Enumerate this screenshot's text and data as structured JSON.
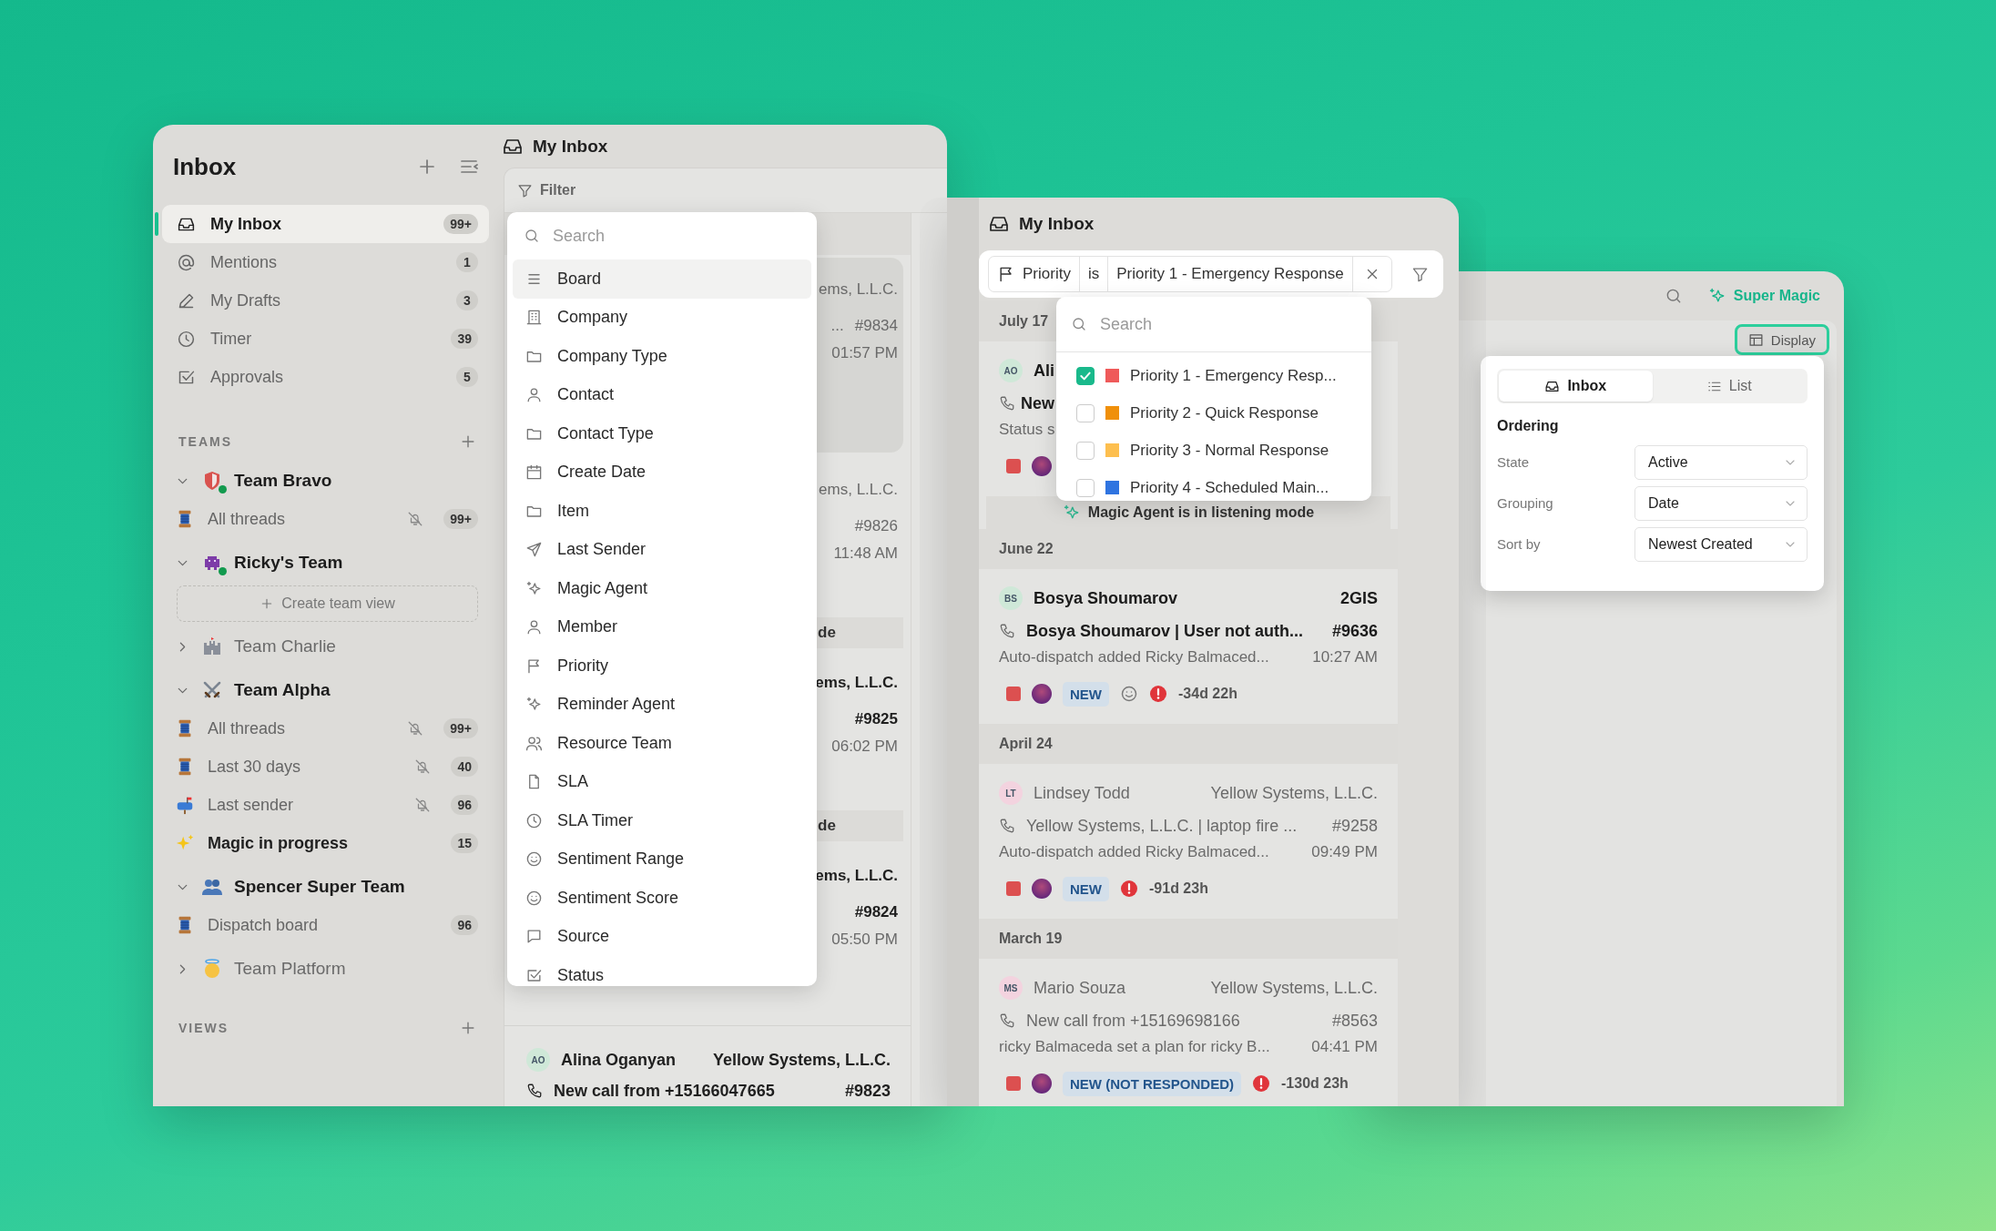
{
  "inbox_window": {
    "sidebar": {
      "title": "Inbox",
      "nav": [
        {
          "label": "My Inbox",
          "count": "99+",
          "selected": true
        },
        {
          "label": "Mentions",
          "count": "1",
          "selected": false
        },
        {
          "label": "My Drafts",
          "count": "3",
          "selected": false
        },
        {
          "label": "Timer",
          "count": "39",
          "selected": false
        },
        {
          "label": "Approvals",
          "count": "5",
          "selected": false
        }
      ],
      "teams_heading": "TEAMS",
      "teams": [
        {
          "name": "Team Bravo",
          "expanded": true,
          "online": true,
          "children": [
            {
              "kind": "view",
              "label": "All threads",
              "muted": true,
              "unread": false,
              "count": "99+"
            }
          ]
        },
        {
          "name": "Ricky's Team",
          "expanded": true,
          "online": true,
          "children": [
            {
              "kind": "create",
              "label": "Create team view"
            }
          ]
        },
        {
          "name": "Team Charlie",
          "expanded": false,
          "online": false
        },
        {
          "name": "Team Alpha",
          "expanded": true,
          "online": false,
          "children": [
            {
              "kind": "view",
              "label": "All threads",
              "muted": true,
              "unread": false,
              "count": "99+"
            },
            {
              "kind": "view",
              "label": "Last 30 days",
              "muted": true,
              "unread": false,
              "count": "40"
            },
            {
              "kind": "view",
              "label": "Last sender",
              "muted": true,
              "unread": false,
              "count": "96"
            },
            {
              "kind": "view",
              "label": "Magic in progress",
              "muted": false,
              "unread": true,
              "count": "15"
            }
          ]
        },
        {
          "name": "Spencer Super Team",
          "expanded": true,
          "online": false,
          "children": [
            {
              "kind": "view",
              "label": "Dispatch board",
              "muted": false,
              "unread": false,
              "count": "96"
            }
          ]
        },
        {
          "name": "Team Platform",
          "expanded": false,
          "online": false
        }
      ],
      "views_heading": "VIEWS"
    },
    "panel": {
      "title": "My Inbox",
      "filter_label": "Filter",
      "filter_menu": {
        "placeholder": "Search",
        "items": [
          {
            "label": "Board",
            "selected": true
          },
          {
            "label": "Company",
            "selected": false
          },
          {
            "label": "Company Type",
            "selected": false
          },
          {
            "label": "Contact",
            "selected": false
          },
          {
            "label": "Contact Type",
            "selected": false
          },
          {
            "label": "Create Date",
            "selected": false
          },
          {
            "label": "Item",
            "selected": false
          },
          {
            "label": "Last Sender",
            "selected": false
          },
          {
            "label": "Magic Agent",
            "selected": false
          },
          {
            "label": "Member",
            "selected": false
          },
          {
            "label": "Priority",
            "selected": false
          },
          {
            "label": "Reminder Agent",
            "selected": false
          },
          {
            "label": "Resource Team",
            "selected": false
          },
          {
            "label": "SLA",
            "selected": false
          },
          {
            "label": "SLA Timer",
            "selected": false
          },
          {
            "label": "Sentiment Range",
            "selected": false
          },
          {
            "label": "Sentiment Score",
            "selected": false
          },
          {
            "label": "Source",
            "selected": false
          },
          {
            "label": "Status",
            "selected": false
          }
        ]
      },
      "rows": [
        {
          "kind": "fragment",
          "company": "ems, L.L.C.",
          "subject": "...",
          "ticket": "#9834",
          "time": "01:57 PM",
          "selected": true,
          "unread": false
        },
        {
          "kind": "fragment",
          "company": "ems, L.L.C.",
          "ticket": "#9826",
          "time": "11:48 AM",
          "selected": false,
          "unread": false
        },
        {
          "kind": "band",
          "text": "de"
        },
        {
          "kind": "fragment",
          "company": "ems, L.L.C.",
          "ticket": "#9825",
          "time": "06:02 PM",
          "selected": false,
          "unread": true
        },
        {
          "kind": "band",
          "text": "de"
        },
        {
          "kind": "fragment",
          "company": "ems, L.L.C.",
          "ticket": "#9824",
          "time": "05:50 PM",
          "selected": false,
          "unread": true
        },
        {
          "kind": "thread",
          "initials": "AO",
          "color": "#cfe8d8",
          "name": "Alina Oganyan",
          "company": "Yellow Systems, L.L.C.",
          "subject": "New call from +15166047665",
          "ticket": "#9823",
          "unread": true
        }
      ]
    }
  },
  "filtered_window": {
    "title": "My Inbox",
    "filter": {
      "field": "Priority",
      "operator": "is",
      "value": "Priority 1 - Emergency Response"
    },
    "priority_menu": {
      "placeholder": "Search",
      "options": [
        {
          "label": "Priority 1 - Emergency Resp...",
          "checked": true,
          "color": "#ef5a5a"
        },
        {
          "label": "Priority 2 - Quick Response",
          "checked": false,
          "color": "#f0900a"
        },
        {
          "label": "Priority 3 - Normal Response",
          "checked": false,
          "color": "#fdbf4f"
        },
        {
          "label": "Priority 4 - Scheduled Main...",
          "checked": false,
          "color": "#2f74e0"
        }
      ]
    },
    "groups": [
      {
        "date": "July 17",
        "items": [
          {
            "kind": "partial",
            "initials": "AO",
            "color": "#cfe8d8",
            "name": "Ali",
            "subject": "New",
            "preview": "Status s"
          },
          {
            "kind": "banner",
            "text": "Magic Agent is in listening mode"
          }
        ]
      },
      {
        "date": "June 22",
        "items": [
          {
            "kind": "thread",
            "initials": "BS",
            "color": "#cfe8d8",
            "name": "Bosya Shoumarov",
            "company": "2GIS",
            "subject": "Bosya Shoumarov | User not auth...",
            "ticket": "#9636",
            "preview": "Auto-dispatch added Ricky Balmaced...",
            "time": "10:27 AM",
            "status": "NEW",
            "sentiment": true,
            "sla": "-34d 22h",
            "unread": true
          }
        ]
      },
      {
        "date": "April 24",
        "items": [
          {
            "kind": "thread",
            "initials": "LT",
            "color": "#f3d3df",
            "name": "Lindsey Todd",
            "company": "Yellow Systems, L.L.C.",
            "subject": "Yellow Systems, L.L.C. | laptop fire ...",
            "ticket": "#9258",
            "preview": "Auto-dispatch added Ricky Balmaced...",
            "time": "09:49 PM",
            "status": "NEW",
            "sentiment": false,
            "sla": "-91d 23h",
            "unread": false
          }
        ]
      },
      {
        "date": "March 19",
        "items": [
          {
            "kind": "thread",
            "initials": "MS",
            "color": "#f3d3df",
            "name": "Mario Souza",
            "company": "Yellow Systems, L.L.C.",
            "subject": "New call from +15169698166",
            "ticket": "#8563",
            "preview": "ricky Balmaceda set a plan for ricky B...",
            "time": "04:41 PM",
            "status": "NEW (NOT RESPONDED)",
            "sentiment": false,
            "sla": "-130d 23h",
            "unread": false
          }
        ]
      }
    ]
  },
  "display_window": {
    "action": "Super Magic",
    "display_button": "Display",
    "display_menu": {
      "tabs": [
        {
          "label": "Inbox",
          "selected": true
        },
        {
          "label": "List",
          "selected": false
        }
      ],
      "heading": "Ordering",
      "settings": [
        {
          "label": "State",
          "value": "Active"
        },
        {
          "label": "Grouping",
          "value": "Date"
        },
        {
          "label": "Sort by",
          "value": "Newest Created"
        }
      ]
    }
  }
}
